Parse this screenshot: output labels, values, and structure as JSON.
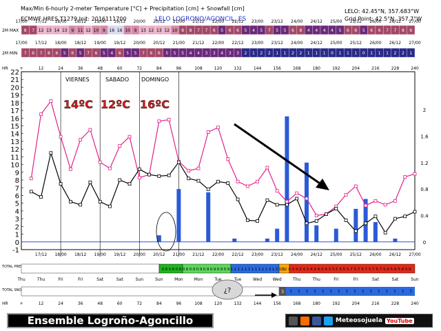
{
  "header": {
    "title": "Max/Min 6-hourly 2-meter Temperature [°C] + Precipitation [cm] + Snowfall [cm]",
    "model_line": "ECMWF HRES T1279 Init: 2016111700",
    "location": "LELO LOGRONO/AGONCIL, ES",
    "station_coords": "LELO: 42.45°N, 357.683°W",
    "grid_point": "Grid Point: 42.5°N, 357.7°W"
  },
  "rows": {
    "max_label": "2M MAX",
    "min_label": "2M MIN",
    "hr_label": "HR",
    "precip_label": "TOTAL PRECIP",
    "snow_label": "TOTAL SNOW",
    "max_values": [
      "8",
      "7",
      "12",
      "13",
      "14",
      "13",
      "9",
      "11",
      "12",
      "10",
      "9",
      "16",
      "16",
      "10",
      "9",
      "13",
      "12",
      "13",
      "12",
      "10",
      "8",
      "8",
      "7",
      "7",
      "6",
      "5",
      "6",
      "6",
      "5",
      "4",
      "5",
      "7",
      "5",
      "5",
      "6",
      "8",
      "4",
      "4",
      "4",
      "4",
      "5",
      "6",
      "6",
      "5",
      "6",
      "6",
      "7",
      "7",
      "8",
      "6"
    ],
    "min_values": [
      "7",
      "6",
      "7",
      "8",
      "6",
      "5",
      "6",
      "5",
      "7",
      "6",
      "5",
      "4",
      "6",
      "5",
      "5",
      "7",
      "6",
      "6",
      "5",
      "5",
      "5",
      "4",
      "4",
      "3",
      "3",
      "4",
      "3",
      "3",
      "2",
      "1",
      "2",
      "2",
      "1",
      "1",
      "2",
      "2",
      "1",
      "1",
      "1",
      "0",
      "1",
      "1",
      "1",
      "0",
      "1",
      "1",
      "1",
      "2",
      "2",
      "1"
    ],
    "snow_values": [
      "7",
      "7",
      "7",
      "7",
      "7",
      "7",
      "7",
      "7",
      "7",
      "7",
      "7",
      "7",
      "7",
      "7",
      "7",
      "7"
    ],
    "precip_values": [
      "3.2",
      "4.3",
      "4.3",
      "4.3",
      "4.3",
      "4.3",
      "4.3",
      "5.5",
      "5.5",
      "5.7",
      "5.7",
      "5.7",
      "5.7",
      "5.7",
      "5.9",
      "5.9",
      "5.9",
      "5.9"
    ],
    "precip_values_green": [
      "0.6",
      "0.6",
      "0.6",
      "0.6",
      "0.9",
      "0.9",
      "0.9",
      "0.9",
      "0.9",
      "0.9",
      "1.1",
      "1.1",
      "1.1",
      "1.1",
      "1.1",
      "1.3",
      "1.3",
      "1.3"
    ],
    "snow_first": "3",
    "top_date_ticks": [
      "17/00",
      "17/12",
      "18/00",
      "18/12",
      "19/00",
      "19/12",
      "20/00",
      "20/12",
      "21/00",
      "21/12",
      "22/00",
      "22/12",
      "23/00",
      "23/12",
      "24/00",
      "24/12",
      "25/00",
      "25/12",
      "26/00",
      "26/12",
      "27/00"
    ],
    "hr_ticks": [
      "+",
      "12",
      "24",
      "36",
      "48",
      "60",
      "72",
      "84",
      "96",
      "108",
      "120",
      "132",
      "144",
      "156",
      "168",
      "180",
      "192",
      "204",
      "216",
      "228",
      "240"
    ],
    "weekdays": [
      "Thu",
      "Thu",
      "Fri",
      "Fri",
      "Sat",
      "Sat",
      "Sun",
      "Sun",
      "Mon",
      "Mon",
      "Tue",
      "Tue",
      "Wed",
      "Wed",
      "Thu",
      "Thu",
      "Fri",
      "Fri",
      "Sat",
      "Sat",
      "Sun"
    ]
  },
  "annotations": {
    "day_labels": [
      "VIERNES",
      "SABADO",
      "DOMINGO"
    ],
    "temps": [
      "14ºC",
      "12ºC",
      "16ºC"
    ],
    "snow_question": "¿?"
  },
  "footer": {
    "banner": "Ensemble Logroño-Agoncillo",
    "brand": "Meteosojuela",
    "youtube": "YouTube"
  },
  "colors": {
    "max_line": "#e0208a",
    "min_line": "#000000",
    "precip_bar": "#2a5bd7",
    "temp_annotation": "#e01818",
    "zero_line": "#3050e0"
  },
  "chart_data": {
    "type": "line",
    "x_unit": "forecast hour",
    "x": [
      6,
      12,
      18,
      24,
      30,
      36,
      42,
      48,
      54,
      60,
      66,
      72,
      78,
      84,
      90,
      96,
      102,
      108,
      114,
      120,
      126,
      132,
      138,
      144,
      150,
      156,
      162,
      168,
      174,
      180,
      186,
      192,
      198,
      204,
      210,
      216,
      222,
      228,
      234,
      240
    ],
    "series": [
      {
        "name": "2M MAX",
        "color": "#e0208a",
        "values": [
          8.2,
          16.5,
          18.2,
          13.6,
          9.4,
          13.2,
          14.5,
          10.3,
          9.5,
          12.4,
          13.6,
          8.3,
          8.7,
          15.6,
          15.8,
          10.4,
          9.2,
          9.5,
          14.2,
          14.8,
          10.7,
          7.8,
          7.2,
          7.8,
          9.6,
          6.6,
          5.2,
          6.3,
          5.6,
          3.4,
          3.6,
          4.6,
          6.1,
          7.2,
          4.7,
          5.3,
          4.8,
          5.3,
          8.4,
          8.8,
          7.7,
          5.2
        ],
        "values_note": "read off chart"
      },
      {
        "name": "2M MIN",
        "color": "#000000",
        "values": [
          6.5,
          5.8,
          11.5,
          7.5,
          5.2,
          4.8,
          7.7,
          5.2,
          4.6,
          8.0,
          7.5,
          9.4,
          8.7,
          8.5,
          8.6,
          10.3,
          8.2,
          7.9,
          6.8,
          7.8,
          7.6,
          5.5,
          2.8,
          2.7,
          5.4,
          4.8,
          4.8,
          5.6,
          2.4,
          2.7,
          3.6,
          4.3,
          2.8,
          1.4,
          2.4,
          3.3,
          1.2,
          3.0,
          3.3,
          3.9,
          4.2,
          3.6
        ]
      }
    ],
    "precip_bars": {
      "x": [
        84,
        96,
        114,
        130,
        150,
        156,
        162,
        174,
        180,
        192,
        204,
        210,
        216,
        228
      ],
      "values": [
        0.1,
        0.8,
        0.75,
        0.05,
        0.05,
        0.2,
        1.9,
        1.2,
        0.25,
        0.2,
        0.5,
        0.65,
        0.3,
        0.05
      ]
    },
    "ylim_temp": [
      -1,
      22
    ],
    "ylim_precip": [
      0,
      2.4
    ],
    "y_ticks_left": [
      -1,
      0,
      1,
      2,
      3,
      4,
      5,
      6,
      7,
      8,
      9,
      10,
      11,
      12,
      13,
      14,
      15,
      16,
      17,
      18,
      19,
      20,
      21,
      22
    ],
    "y_ticks_right": [
      "0",
      "0.4",
      "0.8",
      "1.2",
      "1.6",
      "2"
    ],
    "x_tick_labels": [
      "17/12",
      "18/00",
      "18/12",
      "19/00",
      "19/12",
      "20/00",
      "20/12",
      "21/00",
      "21/12",
      "22/00",
      "22/12",
      "23/00",
      "23/12",
      "24/00",
      "24/12",
      "25/00",
      "25/12",
      "26/00",
      "26/12",
      "27/00"
    ],
    "legend": "none",
    "grid": false
  }
}
